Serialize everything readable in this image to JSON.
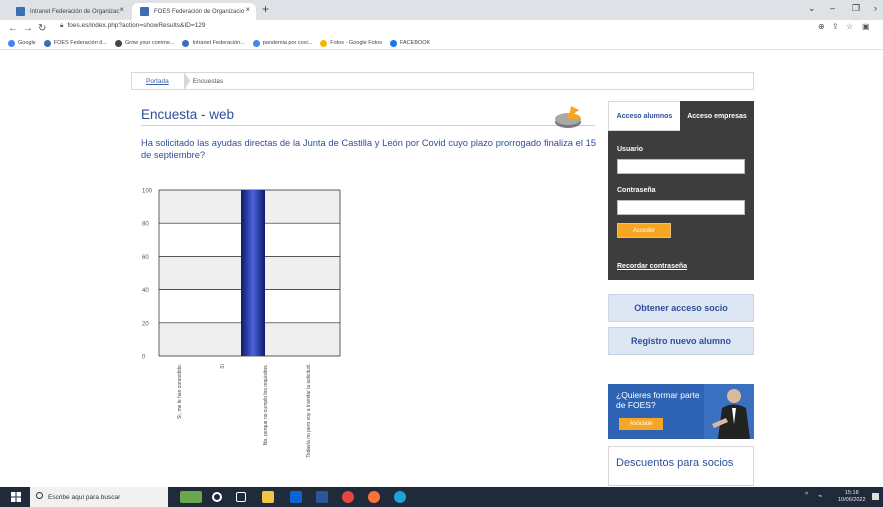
{
  "browser": {
    "tabs": [
      {
        "title": "Intranet Federación de Organizac"
      },
      {
        "title": "FOES Federación de Organizacio"
      }
    ],
    "tab_close": "×",
    "new_tab": "+",
    "url": "foes.es/index.php?action=showResults&ID=129",
    "bookmarks": [
      {
        "label": "Google",
        "color": "#4285f4"
      },
      {
        "label": "FOES Federación d...",
        "color": "#3a6fb5"
      },
      {
        "label": "Grow your comme...",
        "color": "#444444"
      },
      {
        "label": "Intranet Federación...",
        "color": "#3a6fb5"
      },
      {
        "label": "pandemia por covi...",
        "color": "#4285f4"
      },
      {
        "label": "Fotos - Google Fotos",
        "color": "#f4b400"
      },
      {
        "label": "FACEBOOK",
        "color": "#1877f2"
      }
    ]
  },
  "breadcrumb": {
    "home": "Portada",
    "current": "Encuestas"
  },
  "page": {
    "title": "Encuesta - web",
    "question": "Ha solicitado las ayudas directas de la Junta de Castilla y León por Covid cuyo plazo prorrogado finaliza el 15 de septiembre?"
  },
  "chart_data": {
    "type": "bar",
    "categories": [
      "Sí, me le han concedido.",
      "Sí",
      "No, porque no cumplo los requisitos.",
      "Todavía no pero voy a tramitar la solicitud."
    ],
    "values": [
      0,
      100,
      0,
      0
    ],
    "ylim": [
      0,
      100
    ],
    "yticks": [
      0,
      20,
      40,
      60,
      80,
      100
    ],
    "bar_color": "#1f2f8f",
    "grid": true
  },
  "login": {
    "tab_students": "Acceso alumnos",
    "tab_companies": "Acceso empresas",
    "user_label": "Usuario",
    "password_label": "Contraseña",
    "submit": "Acceder",
    "forgot": "Recordar contraseña"
  },
  "sidebar": {
    "member_access": "Obtener acceso socio",
    "register_student": "Registro nuevo alumno",
    "banner_text": "¿Quieres formar parte de FOES?",
    "banner_button": "Asóciate",
    "discounts": "Descuentos para socios"
  },
  "taskbar": {
    "search_placeholder": "Escribe aquí para buscar",
    "time": "15:18",
    "date": "10/06/2022"
  }
}
